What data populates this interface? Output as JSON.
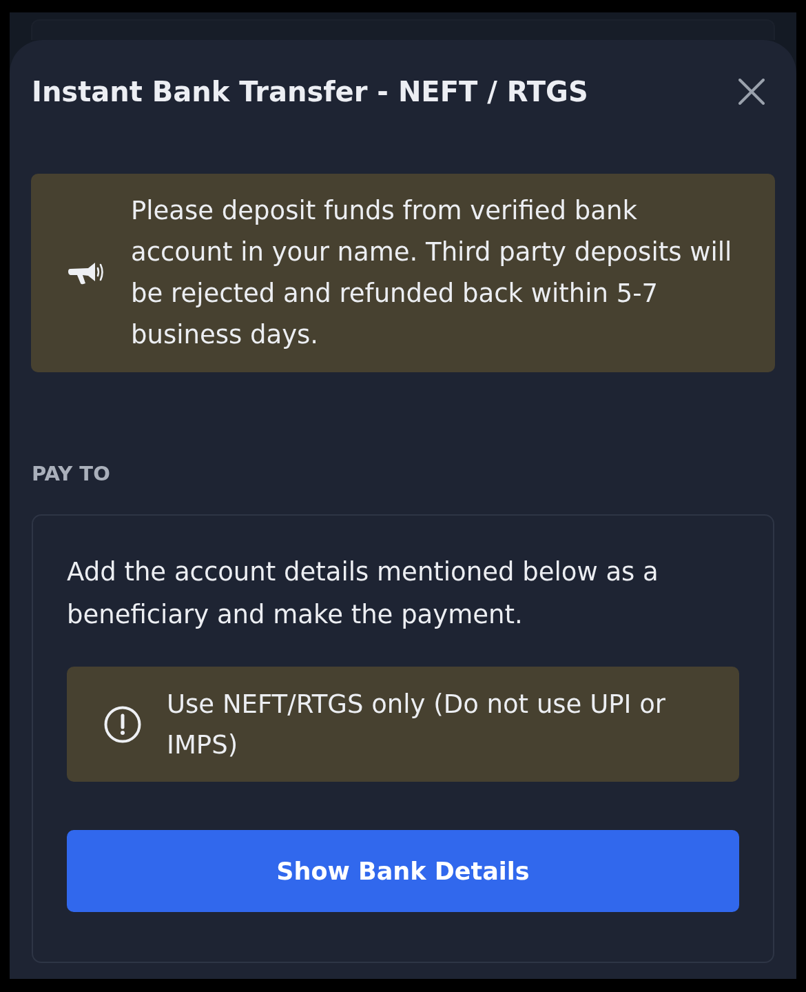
{
  "modal": {
    "title": "Instant Bank Transfer - NEFT / RTGS"
  },
  "notice": {
    "kind": "announcement",
    "text": "Please deposit funds from verified bank account in your name. Third party deposits will be rejected and refunded back within 5-7 business days."
  },
  "pay_to": {
    "label": "PAY TO",
    "instructions": "Add the account details mentioned below as a beneficiary and make the payment.",
    "warning": {
      "kind": "caution",
      "text": "Use NEFT/RTGS only (Do not use UPI or IMPS)"
    },
    "button": {
      "label": "Show Bank Details"
    }
  }
}
